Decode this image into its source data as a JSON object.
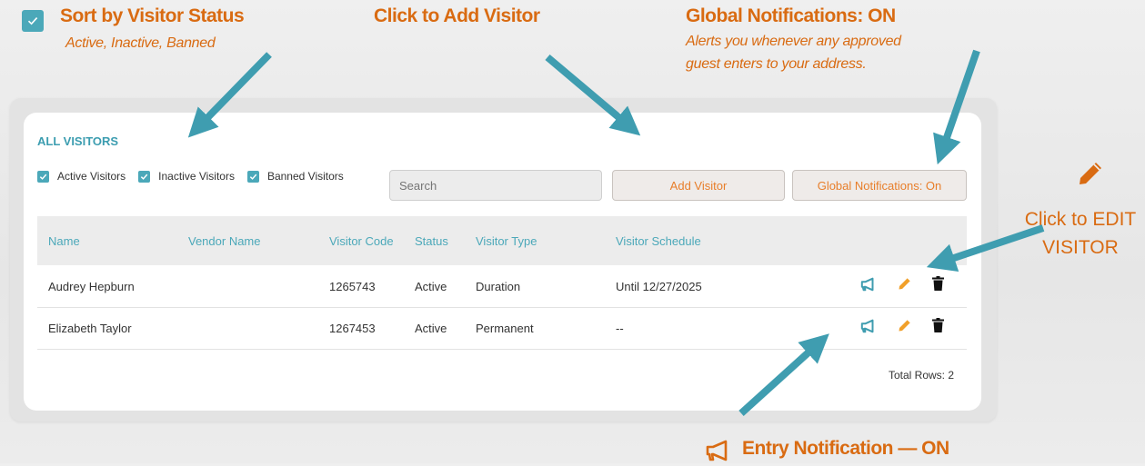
{
  "annotations": {
    "sort": {
      "title": "Sort by Visitor Status",
      "subtitle": "Active, Inactive, Banned"
    },
    "add": {
      "title": "Click to Add Visitor"
    },
    "global": {
      "title": "Global Notifications: ON",
      "line1": "Alerts you whenever any approved",
      "line2": "guest enters to your address."
    },
    "edit": {
      "line1": "Click to EDIT",
      "line2": "VISITOR"
    },
    "entry": {
      "title": "Entry Notification — ON"
    }
  },
  "card": {
    "title": "ALL VISITORS",
    "filters": [
      "Active Visitors",
      "Inactive Visitors",
      "Banned Visitors"
    ],
    "search_placeholder": "Search",
    "add_button": "Add Visitor",
    "global_button": "Global Notifications: On"
  },
  "table": {
    "columns": [
      "Name",
      "Vendor Name",
      "Visitor Code",
      "Status",
      "Visitor Type",
      "Visitor Schedule"
    ],
    "rows": [
      {
        "name": "Audrey Hepburn",
        "vendor": "",
        "code": "1265743",
        "status": "Active",
        "type": "Duration",
        "schedule": "Until 12/27/2025"
      },
      {
        "name": "Elizabeth Taylor",
        "vendor": "",
        "code": "1267453",
        "status": "Active",
        "type": "Permanent",
        "schedule": "--"
      }
    ],
    "total": "Total Rows: 2"
  },
  "colors": {
    "accent": "#4ba8b9",
    "orange": "#d96b12",
    "button_text": "#e87e2a"
  },
  "icons": [
    "checkbox-icon",
    "megaphone-icon",
    "pencil-icon",
    "trash-icon",
    "arrow-icon"
  ]
}
